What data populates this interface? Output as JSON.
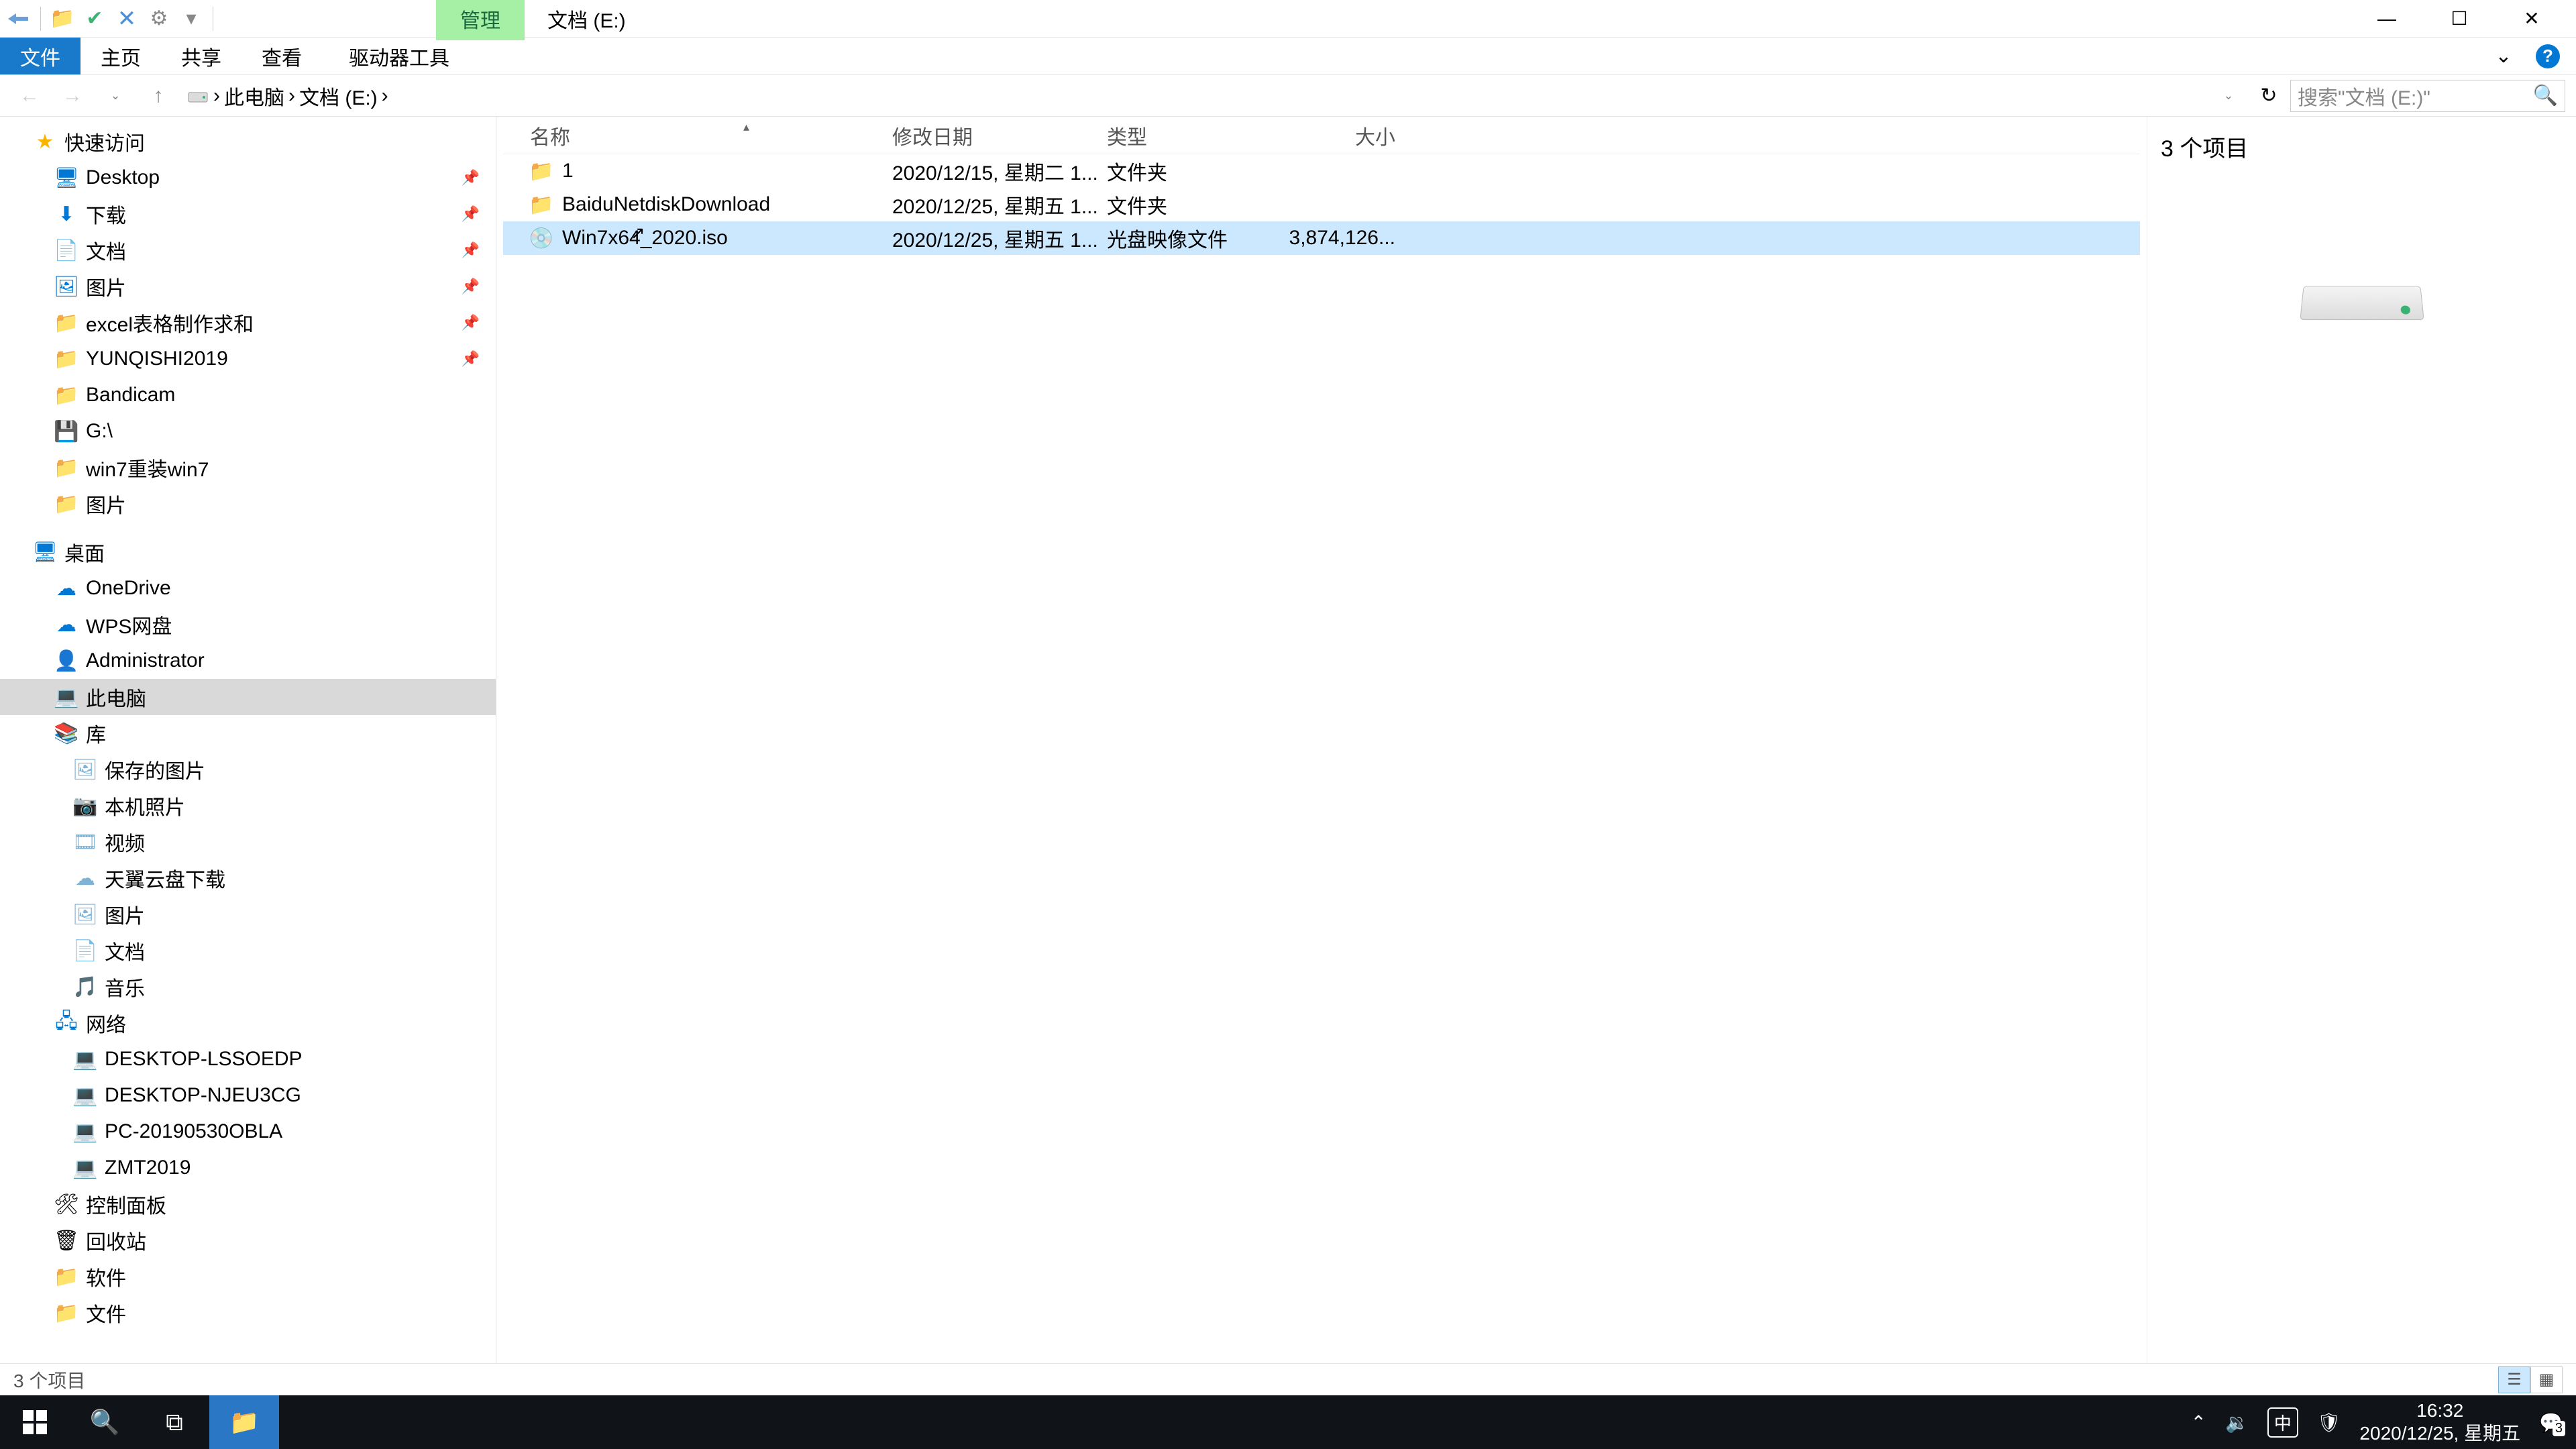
{
  "title_context_tab": "管理",
  "window_title": "文档 (E:)",
  "ribbon": {
    "file": "文件",
    "home": "主页",
    "share": "共享",
    "view": "查看",
    "drive_tools": "驱动器工具"
  },
  "breadcrumb": {
    "this_pc": "此电脑",
    "drive": "文档 (E:)"
  },
  "search_placeholder": "搜索\"文档 (E:)\"",
  "columns": {
    "name": "名称",
    "date": "修改日期",
    "type": "类型",
    "size": "大小"
  },
  "rows": [
    {
      "name": "1",
      "date": "2020/12/15, 星期二 1...",
      "type": "文件夹",
      "size": "",
      "icon": "folder",
      "selected": false
    },
    {
      "name": "BaiduNetdiskDownload",
      "date": "2020/12/25, 星期五 1...",
      "type": "文件夹",
      "size": "",
      "icon": "folder",
      "selected": false
    },
    {
      "name": "Win7x64_2020.iso",
      "date": "2020/12/25, 星期五 1...",
      "type": "光盘映像文件",
      "size": "3,874,126...",
      "icon": "iso",
      "selected": true
    }
  ],
  "preview_title": "3 个项目",
  "statusbar_text": "3 个项目",
  "sidebar": {
    "quick_access": "快速访问",
    "desktop": "Desktop",
    "downloads": "下载",
    "documents": "文档",
    "pictures": "图片",
    "excel": "excel表格制作求和",
    "yunqishi": "YUNQISHI2019",
    "bandicam": "Bandicam",
    "gdrive": "G:\\",
    "win7reinstall": "win7重装win7",
    "pictures2": "图片",
    "desktop_section": "桌面",
    "onedrive": "OneDrive",
    "wps": "WPS网盘",
    "administrator": "Administrator",
    "this_pc": "此电脑",
    "libraries": "库",
    "saved_pictures": "保存的图片",
    "camera_roll": "本机照片",
    "videos": "视频",
    "tianyi": "天翼云盘下载",
    "lib_pictures": "图片",
    "lib_documents": "文档",
    "music": "音乐",
    "network": "网络",
    "pc1": "DESKTOP-LSSOEDP",
    "pc2": "DESKTOP-NJEU3CG",
    "pc3": "PC-20190530OBLA",
    "pc4": "ZMT2019",
    "control_panel": "控制面板",
    "recycle_bin": "回收站",
    "software": "软件",
    "file": "文件"
  },
  "taskbar": {
    "time": "16:32",
    "date": "2020/12/25, 星期五",
    "ime": "中",
    "notification_count": "3"
  }
}
